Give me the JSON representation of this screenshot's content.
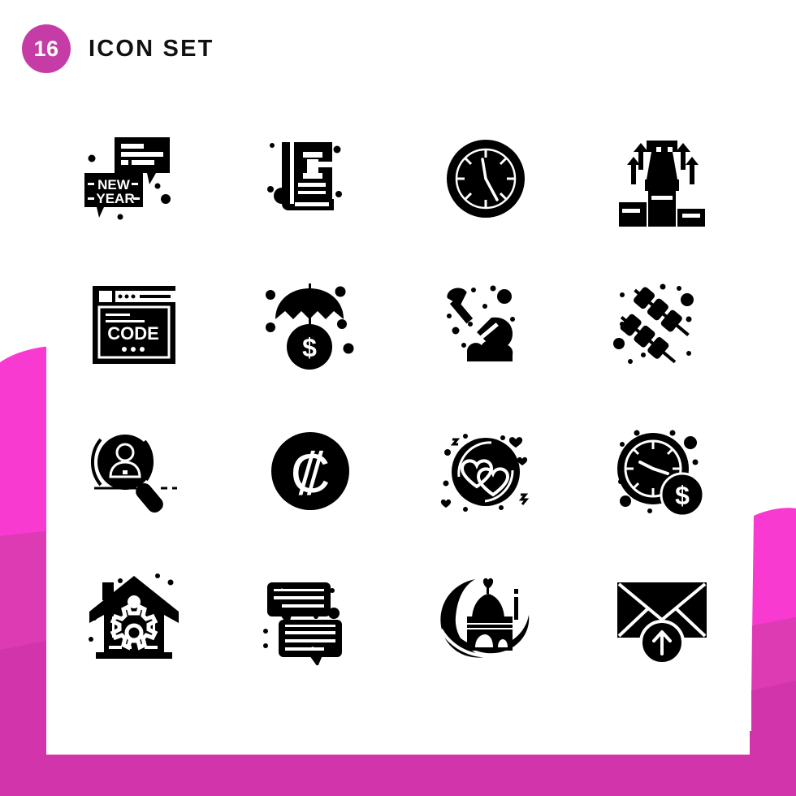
{
  "header": {
    "count": "16",
    "title": "Icon Set",
    "badge_color": "#c63ca6",
    "title_color": "#111111"
  },
  "theme": {
    "background": "#ffffff",
    "card_background": "#ffffff",
    "icon_color": "#000000",
    "accent_pink_bright": "#f83ad0",
    "accent_pink_mid": "#dc3bb4",
    "accent_pink_deep": "#d235ab"
  },
  "grid": {
    "columns": 4,
    "rows": 4,
    "total": 16
  },
  "icons": [
    {
      "index": 1,
      "name": "new-year-chat-icon",
      "label": "New Year Chat Bubbles",
      "text": [
        "NEW",
        "YEAR"
      ]
    },
    {
      "index": 2,
      "name": "law-book-gavel-icon",
      "label": "Law Book With Gavel",
      "text": []
    },
    {
      "index": 3,
      "name": "wall-clock-icon",
      "label": "Wall Clock",
      "text": []
    },
    {
      "index": 4,
      "name": "chess-rook-podium-icon",
      "label": "Chess Rook On Podium",
      "text": []
    },
    {
      "index": 5,
      "name": "code-browser-icon",
      "label": "Code Browser Window",
      "text": [
        "CODE"
      ]
    },
    {
      "index": 6,
      "name": "umbrella-dollar-icon",
      "label": "Umbrella Protecting Dollar",
      "text": [
        "$"
      ]
    },
    {
      "index": 7,
      "name": "shovel-sand-icon",
      "label": "Shovel Digging Sand",
      "text": []
    },
    {
      "index": 8,
      "name": "kebab-skewers-icon",
      "label": "Kebab Skewers",
      "text": []
    },
    {
      "index": 9,
      "name": "search-person-icon",
      "label": "Magnifier With Person",
      "text": []
    },
    {
      "index": 10,
      "name": "colon-currency-coin-icon",
      "label": "Colon Currency Coin",
      "text": [
        "₡"
      ]
    },
    {
      "index": 11,
      "name": "hearts-coin-icon",
      "label": "Two Hearts In Circle",
      "text": []
    },
    {
      "index": 12,
      "name": "clock-dollar-icon",
      "label": "Clock With Dollar Coin",
      "text": [
        "$"
      ]
    },
    {
      "index": 13,
      "name": "smart-home-gear-icon",
      "label": "Smart Home With Gear",
      "text": []
    },
    {
      "index": 14,
      "name": "chat-conversation-icon",
      "label": "Chat Conversation Bubbles",
      "text": []
    },
    {
      "index": 15,
      "name": "mosque-crescent-icon",
      "label": "Mosque With Crescent",
      "text": []
    },
    {
      "index": 16,
      "name": "send-email-icon",
      "label": "Envelope With Upload Arrow",
      "text": []
    }
  ]
}
